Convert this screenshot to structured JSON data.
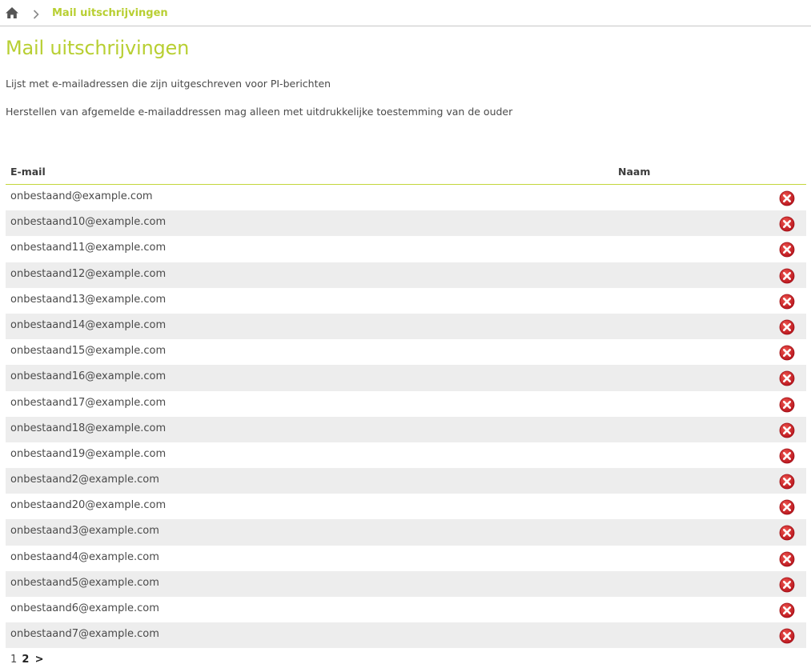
{
  "breadcrumb": {
    "home_icon": "home-icon",
    "separator_icon": "chevron-right-icon",
    "current": "Mail uitschrijvingen"
  },
  "page": {
    "title": "Mail uitschrijvingen",
    "description_1": "Lijst met e-mailadressen die zijn uitgeschreven voor PI-berichten",
    "description_2": "Herstellen van afgemelde e-mailaddressen mag alleen met uitdrukkelijke toestemming van de ouder"
  },
  "table": {
    "columns": {
      "email": "E-mail",
      "naam": "Naam"
    },
    "remove_icon": "remove-icon",
    "rows": [
      {
        "email": "onbestaand@example.com",
        "naam": ""
      },
      {
        "email": "onbestaand10@example.com",
        "naam": ""
      },
      {
        "email": "onbestaand11@example.com",
        "naam": ""
      },
      {
        "email": "onbestaand12@example.com",
        "naam": ""
      },
      {
        "email": "onbestaand13@example.com",
        "naam": ""
      },
      {
        "email": "onbestaand14@example.com",
        "naam": ""
      },
      {
        "email": "onbestaand15@example.com",
        "naam": ""
      },
      {
        "email": "onbestaand16@example.com",
        "naam": ""
      },
      {
        "email": "onbestaand17@example.com",
        "naam": ""
      },
      {
        "email": "onbestaand18@example.com",
        "naam": ""
      },
      {
        "email": "onbestaand19@example.com",
        "naam": ""
      },
      {
        "email": "onbestaand2@example.com",
        "naam": ""
      },
      {
        "email": "onbestaand20@example.com",
        "naam": ""
      },
      {
        "email": "onbestaand3@example.com",
        "naam": ""
      },
      {
        "email": "onbestaand4@example.com",
        "naam": ""
      },
      {
        "email": "onbestaand5@example.com",
        "naam": ""
      },
      {
        "email": "onbestaand6@example.com",
        "naam": ""
      },
      {
        "email": "onbestaand7@example.com",
        "naam": ""
      }
    ]
  },
  "pagination": {
    "page_1": "1",
    "page_2": "2",
    "next": ">",
    "current_page": 2
  },
  "colors": {
    "accent": "#b8cf32",
    "row_alt": "#ededed",
    "remove_red": "#d8191e"
  }
}
